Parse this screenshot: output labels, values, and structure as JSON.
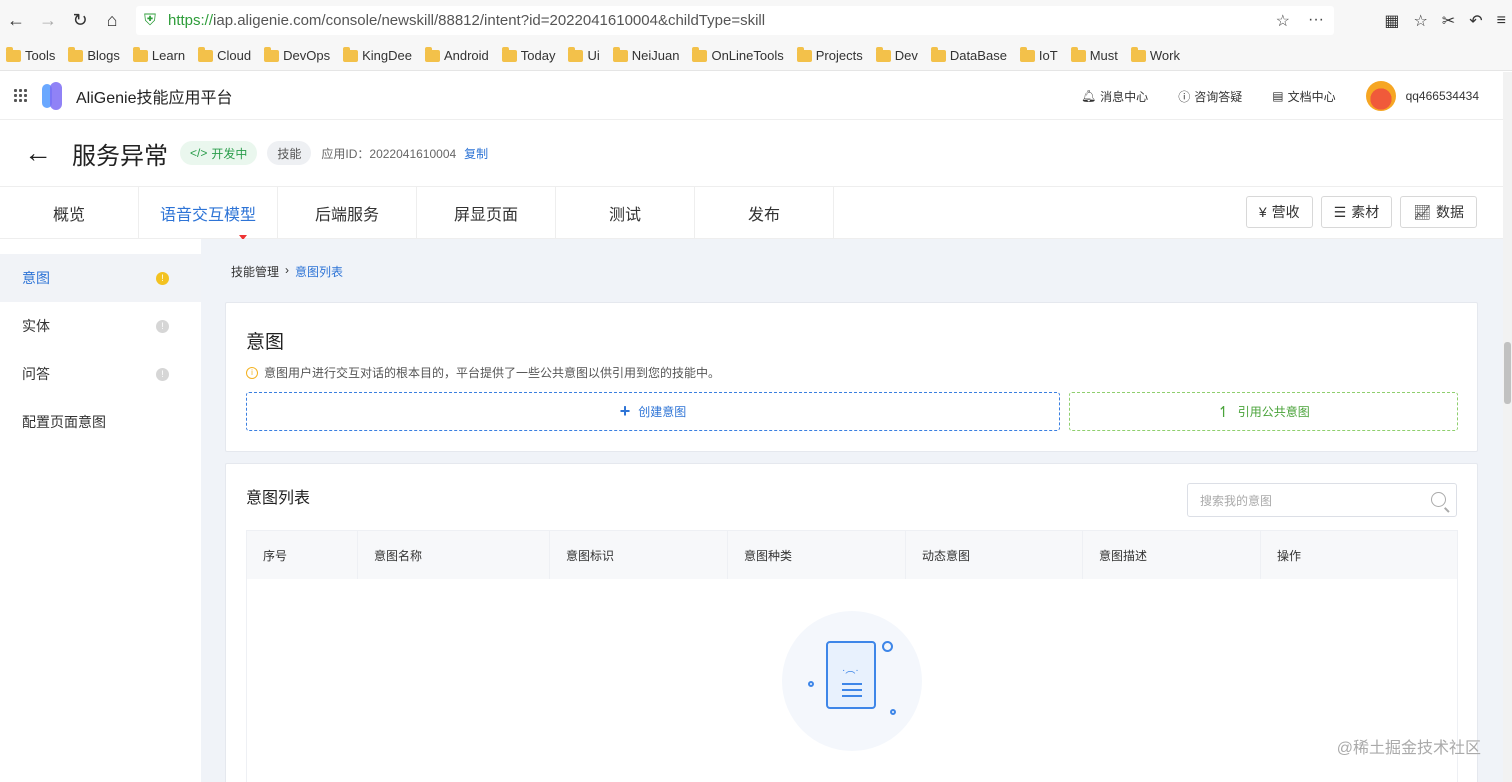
{
  "browser": {
    "url_https": "https://",
    "url_rest": "iap.aligenie.com/console/newskill/88812/intent?id=2022041610004&childType=skill"
  },
  "bookmarks": [
    "Tools",
    "Blogs",
    "Learn",
    "Cloud",
    "DevOps",
    "KingDee",
    "Android",
    "Today",
    "Ui",
    "NeiJuan",
    "OnLineTools",
    "Projects",
    "Dev",
    "DataBase",
    "IoT",
    "Must",
    "Work"
  ],
  "header": {
    "app_name": "AliGenie技能应用平台",
    "messages": "消息中心",
    "faq": "咨询答疑",
    "docs": "文档中心",
    "username": "qq466534434"
  },
  "title": {
    "text": "服务异常",
    "status": "开发中",
    "type_tag": "技能",
    "app_id_label": "应用ID：",
    "app_id": "2022041610004",
    "copy": "复制"
  },
  "tabs": [
    "概览",
    "语音交互模型",
    "后端服务",
    "屏显页面",
    "测试",
    "发布"
  ],
  "tab_buttons": {
    "revenue": "营收",
    "assets": "素材",
    "data": "数据"
  },
  "sidebar": {
    "items": [
      {
        "label": "意图"
      },
      {
        "label": "实体"
      },
      {
        "label": "问答"
      },
      {
        "label": "配置页面意图"
      }
    ]
  },
  "breadcrumb": {
    "parent": "技能管理",
    "current": "意图列表"
  },
  "intent_card": {
    "title": "意图",
    "hint": "意图用户进行交互对话的根本目的，平台提供了一些公共意图以供引用到您的技能中。",
    "create": "创建意图",
    "reference": "引用公共意图"
  },
  "list_card": {
    "title": "意图列表",
    "search_placeholder": "搜索我的意图",
    "columns": [
      "序号",
      "意图名称",
      "意图标识",
      "意图种类",
      "动态意图",
      "意图描述",
      "操作"
    ]
  },
  "watermark": "@稀土掘金技术社区",
  "colors": {
    "accent": "#2e74d6",
    "green": "#2a9d4b",
    "warn": "#f3c221"
  }
}
